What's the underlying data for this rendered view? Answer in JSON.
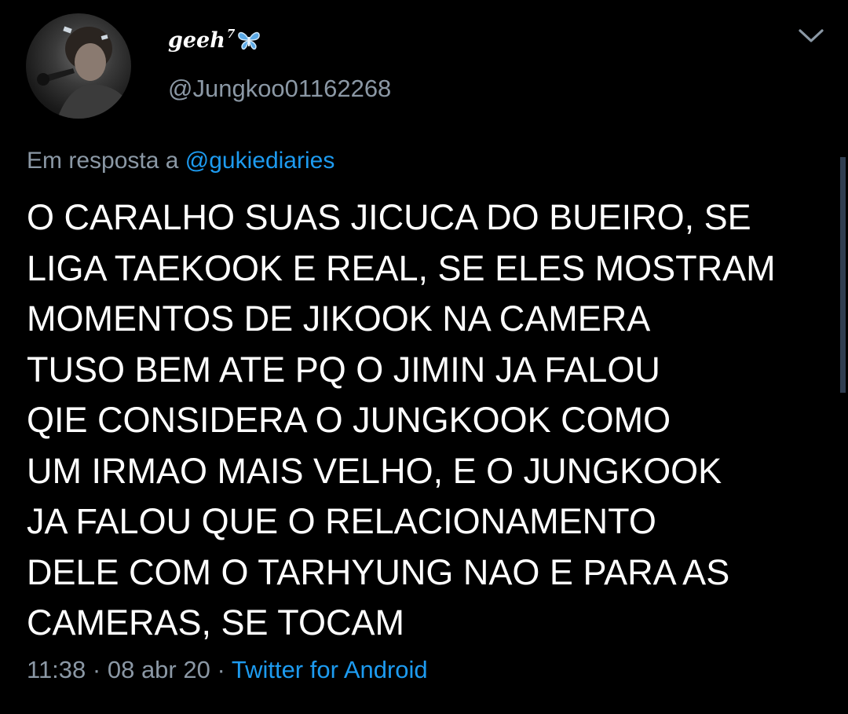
{
  "author": {
    "display_name": "geeh",
    "name_superscript": "7",
    "name_emoji_icon": "butterfly-icon",
    "handle": "@Jungkoo01162268"
  },
  "reply": {
    "prefix": "Em resposta a",
    "mention": "@gukiediaries"
  },
  "tweet_text_lines": [
    "O CARALHO SUAS JICUCA DO BUEIRO, SE",
    "LIGA TAEKOOK E REAL, SE ELES MOSTRAM",
    "MOMENTOS DE JIKOOK NA CAMERA",
    "TUSO BEM ATE PQ O JIMIN JA FALOU",
    "QIE CONSIDERA O JUNGKOOK COMO",
    "UM IRMAO MAIS VELHO, E O JUNGKOOK",
    "JA FALOU QUE O RELACIONAMENTO",
    "DELE COM O TARHYUNG NAO E PARA AS",
    "CAMERAS, SE TOCAM"
  ],
  "meta": {
    "time": "11:38",
    "separator": " · ",
    "date": "08 abr 20",
    "source": "Twitter for Android"
  },
  "icons": {
    "menu": "chevron-down-icon",
    "avatar": "avatar"
  },
  "colors": {
    "background": "#000000",
    "text_primary": "#ffffff",
    "text_secondary": "#8b98a5",
    "link": "#1d9bf0"
  }
}
